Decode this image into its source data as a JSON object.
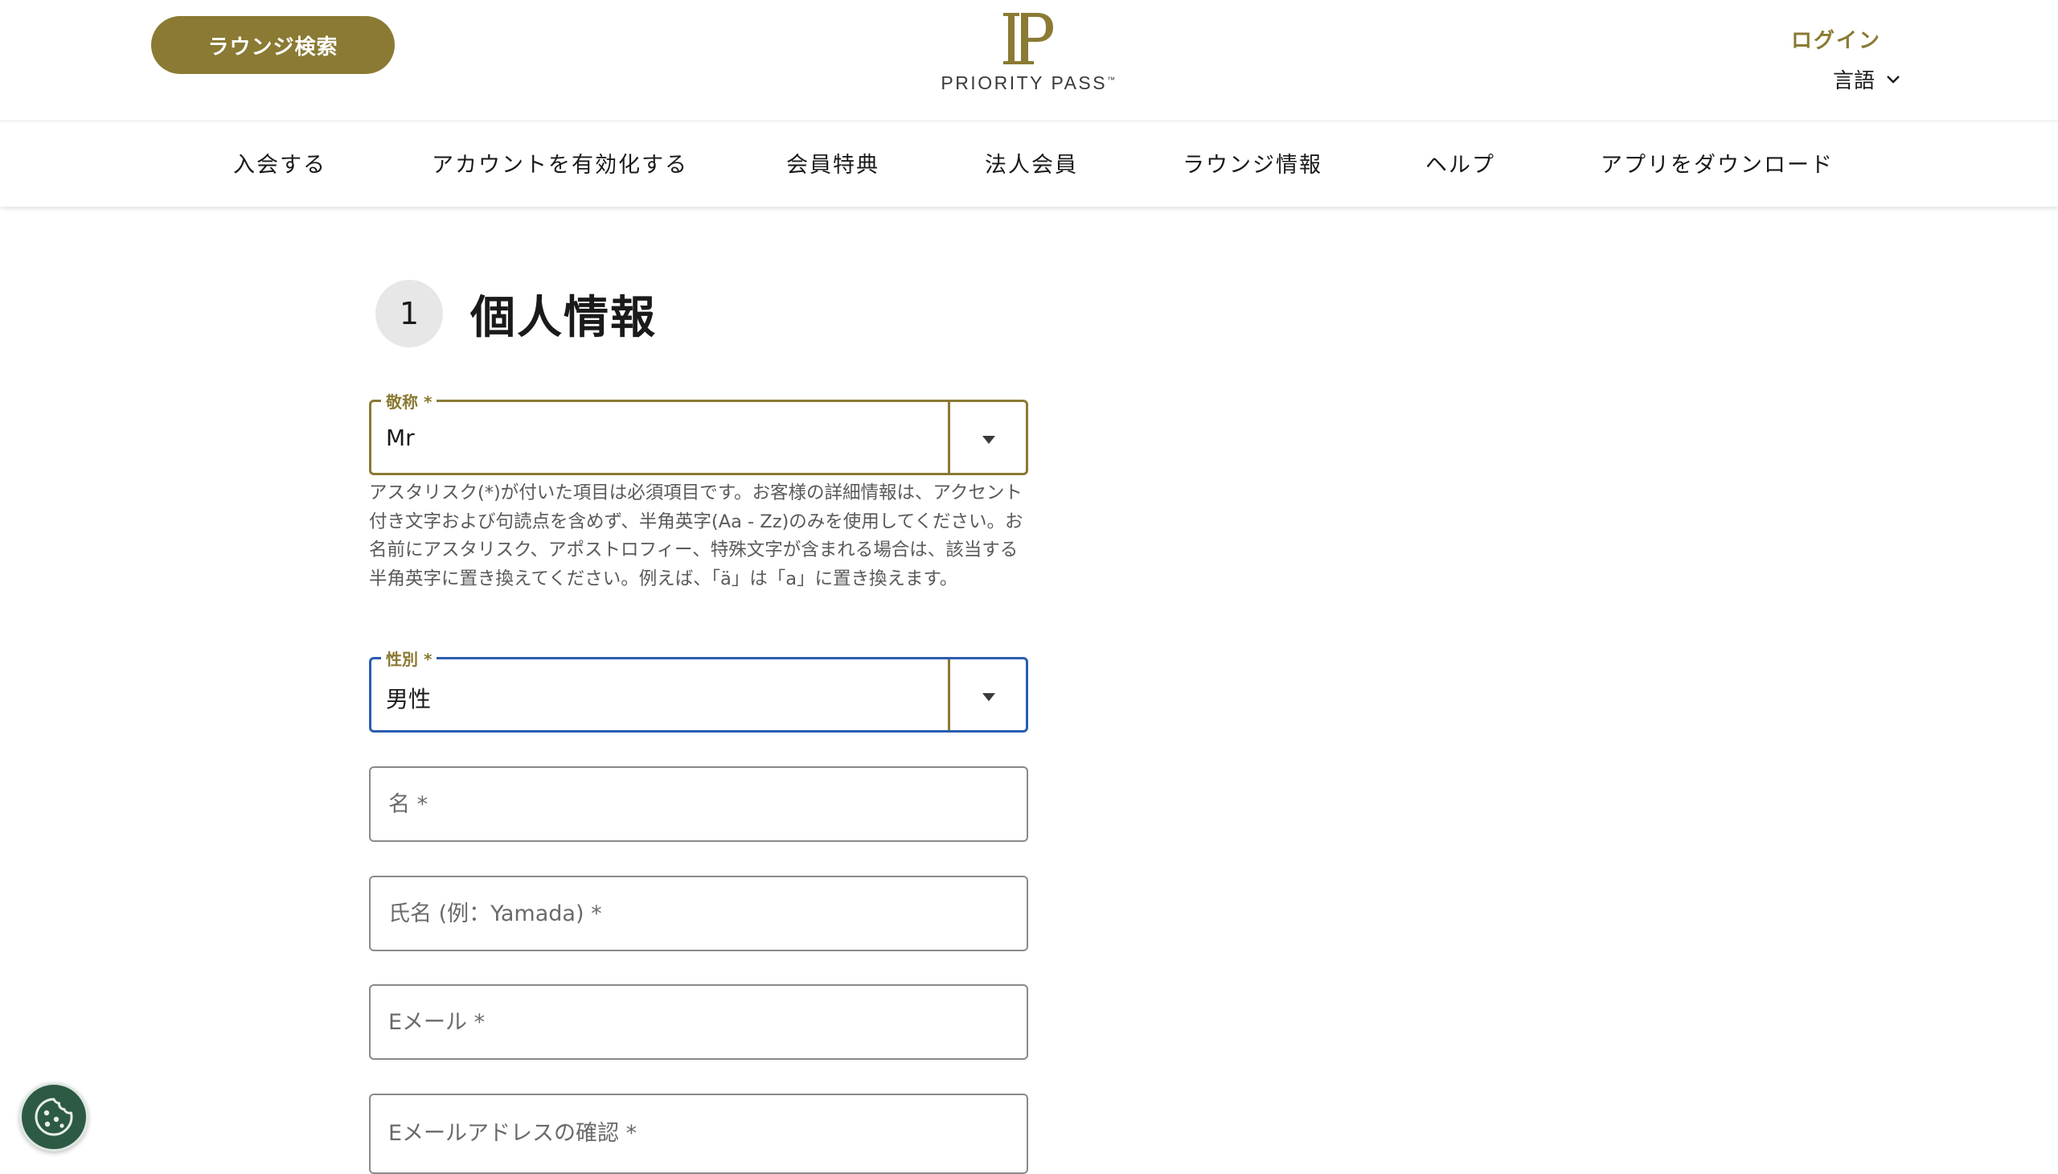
{
  "header": {
    "lounge_search_label": "ラウンジ検索",
    "logo_text": "PRIORITY PASS",
    "logo_tm": "™",
    "login_label": "ログイン",
    "language_label": "言語"
  },
  "nav": {
    "items": [
      {
        "label": "入会する"
      },
      {
        "label": "アカウントを有効化する"
      },
      {
        "label": "会員特典"
      },
      {
        "label": "法人会員"
      },
      {
        "label": "ラウンジ情報"
      },
      {
        "label": "ヘルプ"
      },
      {
        "label": "アプリをダウンロード"
      }
    ]
  },
  "form": {
    "step_number": "1",
    "section_title": "個人情報",
    "title_field": {
      "label": "敬称 *",
      "value": "Mr"
    },
    "helper_text": "アスタリスク(*)が付いた項目は必須項目です。お客様の詳細情報は、アクセント付き文字および句読点を含めず、半角英字(Aa - Zz)のみを使用してください。お名前にアスタリスク、アポストロフィー、特殊文字が含まれる場合は、該当する半角英字に置き換えてください。例えば、「ä」は「a」に置き換えます。",
    "gender_field": {
      "label": "性別 *",
      "value": "男性"
    },
    "first_name": {
      "placeholder": "名 *",
      "value": ""
    },
    "last_name": {
      "placeholder": "氏名 (例：Yamada) *",
      "value": ""
    },
    "email": {
      "placeholder": "Eメール *",
      "value": ""
    },
    "email_confirm": {
      "placeholder": "Eメールアドレスの確認 *",
      "value": ""
    }
  },
  "colors": {
    "brand_gold": "#8a7a33",
    "focus_blue": "#2a5db0",
    "cookie_green": "#2d5a45"
  },
  "icons": {
    "language_chevron": "chevron-down-icon",
    "select_arrow": "caret-down-icon",
    "cookie": "cookie-icon"
  }
}
